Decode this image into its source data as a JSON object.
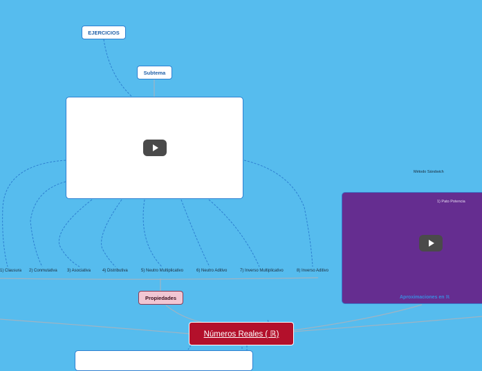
{
  "main_topic": {
    "label": "Números Reales  ( ℝ)"
  },
  "exercises": {
    "label": "EJERCICIOS"
  },
  "subtopic": {
    "label": "Subtema"
  },
  "properties": {
    "label": "Propiedades",
    "items": [
      "1) Clausura",
      "2) Conmutativa",
      "3) Asociativa",
      "4) Distributiva",
      "5) Neutro Multiplicativo",
      "6) Neutro Aditivo",
      "7) Inverso Multiplicativo",
      "8) Inverso Aditivo"
    ]
  },
  "approximations": {
    "method_label": "Método Sándwich",
    "item_label": "1) Pato Potencia",
    "label": "Aproximaciones en ℝ"
  },
  "colors": {
    "background": "#56bcee",
    "main_node": "#b3102b",
    "properties_node": "#f1c6d3",
    "video_panel": "#652d90",
    "link": "#2d7fd0"
  },
  "icons": {
    "video": "play-icon"
  }
}
